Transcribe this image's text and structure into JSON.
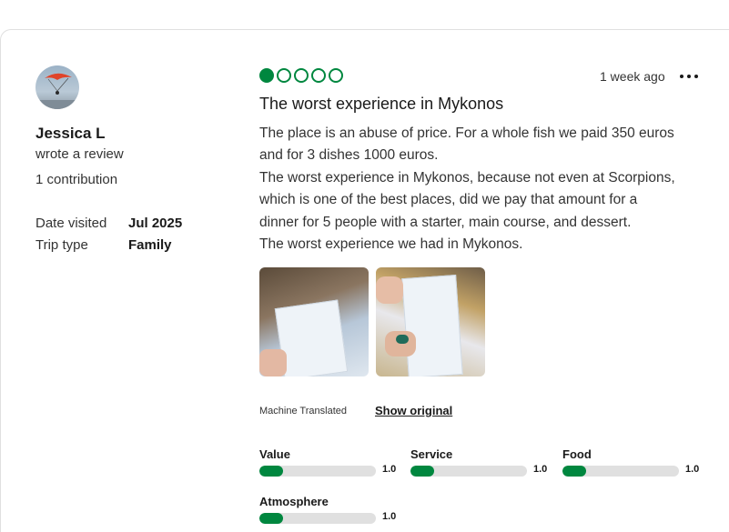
{
  "reviewer": {
    "name": "Jessica L",
    "action": "wrote a review",
    "contributions": "1 contribution",
    "date_visited_label": "Date visited",
    "date_visited_value": "Jul 2025",
    "trip_type_label": "Trip type",
    "trip_type_value": "Family"
  },
  "review": {
    "rating": 1,
    "rating_max": 5,
    "posted": "1 week ago",
    "title": "The worst experience in Mykonos",
    "body_lines": [
      "The place is an abuse of price. For a whole fish we paid 350 euros",
      "and for 3 dishes 1000 euros.",
      "The worst experience in Mykonos, because not even at Scorpions,",
      "which is one of the best places, did we pay that amount for a",
      "dinner for 5 people with a starter, main course, and dessert.",
      "The worst experience we had in Mykonos."
    ],
    "machine_translated": "Machine Translated",
    "show_original": "Show original"
  },
  "subratings": [
    {
      "label": "Value",
      "value": "1.0",
      "fraction": 0.2
    },
    {
      "label": "Service",
      "value": "1.0",
      "fraction": 0.2
    },
    {
      "label": "Food",
      "value": "1.0",
      "fraction": 0.2
    },
    {
      "label": "Atmosphere",
      "value": "1.0",
      "fraction": 0.2
    }
  ],
  "colors": {
    "accent": "#00873f",
    "track": "#e0e0e0"
  },
  "icons": {
    "more": "more-horizontal-icon",
    "avatar": "avatar-photo"
  }
}
